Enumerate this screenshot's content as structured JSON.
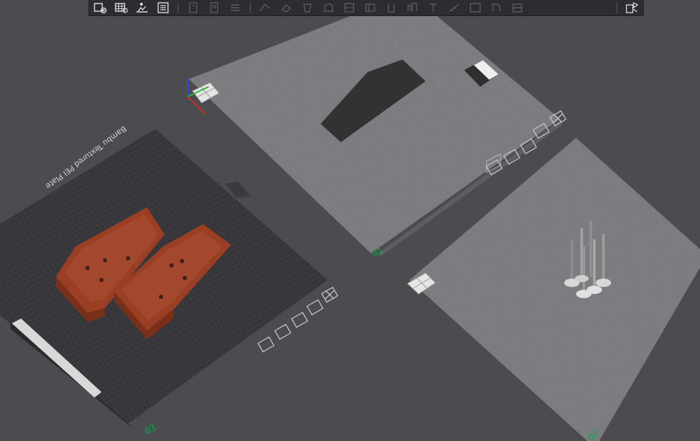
{
  "toolbar": {
    "left_group": [
      {
        "icon": "add-plate-icon",
        "enabled": true
      },
      {
        "icon": "arrange-grid-icon",
        "enabled": true
      },
      {
        "icon": "auto-orient-icon",
        "enabled": true
      },
      {
        "icon": "plate-list-icon",
        "enabled": true
      }
    ],
    "middle_group": [
      {
        "icon": "layers-icon",
        "enabled": false
      },
      {
        "icon": "slice-page-icon",
        "enabled": false
      },
      {
        "icon": "menu-list-icon",
        "enabled": false
      }
    ],
    "right_group": [
      {
        "icon": "move-icon",
        "enabled": false
      },
      {
        "icon": "rotate-icon",
        "enabled": false
      },
      {
        "icon": "scale-icon",
        "enabled": false
      },
      {
        "icon": "lay-flat-icon",
        "enabled": false
      },
      {
        "icon": "cut-icon",
        "enabled": false
      },
      {
        "icon": "support-paint-icon",
        "enabled": false
      },
      {
        "icon": "seam-paint-icon",
        "enabled": false
      },
      {
        "icon": "color-paint-icon",
        "enabled": false
      },
      {
        "icon": "text-emboss-icon",
        "enabled": false
      },
      {
        "icon": "measure-icon",
        "enabled": false
      },
      {
        "icon": "assembly-icon",
        "enabled": false
      },
      {
        "icon": "mesh-boolean-icon",
        "enabled": false
      },
      {
        "icon": "variable-layer-icon",
        "enabled": false
      }
    ],
    "end_icon": "split-view-icon"
  },
  "plates": {
    "plate_01": {
      "number": "01",
      "selected": false
    },
    "plate_02": {
      "number": "02",
      "selected": false
    },
    "plate_03": {
      "number": "03",
      "selected": true,
      "bed_label": "Bambu Textured PEI Plate"
    }
  },
  "colors": {
    "background": "#4b4b50",
    "grid_plate": "#808085",
    "textured_plate": "#37373b",
    "part_orange": "#9a3e24",
    "part_dark": "#333333",
    "part_white": "#dedede",
    "plate_number": "#00ae42"
  },
  "plate_controls": [
    "camera-icon",
    "orient-icon",
    "arrange-icon",
    "lock-icon",
    "delete-icon"
  ]
}
